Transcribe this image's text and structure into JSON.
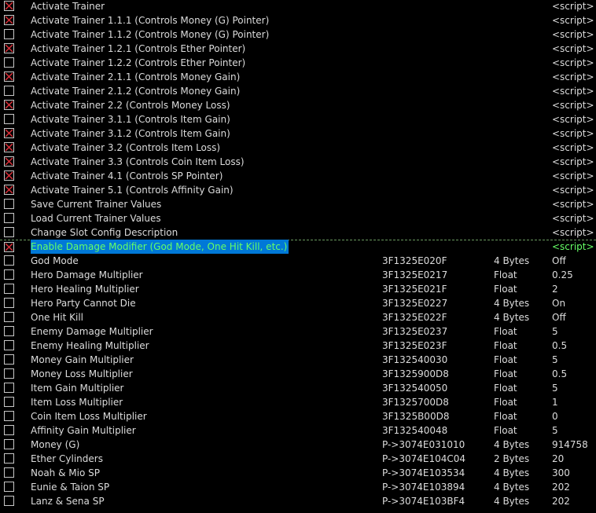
{
  "colors": {
    "background": "#000000",
    "text": "#dcdcdc",
    "checkmark": "#e0303a",
    "selection_bg": "#0078d7",
    "selection_text": "#66ff66"
  },
  "icons": {
    "checkbox_checked": "red-x-checkbox-icon",
    "checkbox_unchecked": "empty-checkbox-icon"
  },
  "rows": [
    {
      "checked": true,
      "description": "Activate Trainer",
      "address": "",
      "type": "",
      "value": "<script>"
    },
    {
      "checked": true,
      "description": "Activate Trainer 1.1.1 (Controls Money (G) Pointer)",
      "address": "",
      "type": "",
      "value": "<script>"
    },
    {
      "checked": false,
      "description": "Activate Trainer 1.1.2 (Controls Money (G) Pointer)",
      "address": "",
      "type": "",
      "value": "<script>"
    },
    {
      "checked": true,
      "description": "Activate Trainer 1.2.1 (Controls Ether Pointer)",
      "address": "",
      "type": "",
      "value": "<script>"
    },
    {
      "checked": false,
      "description": "Activate Trainer 1.2.2 (Controls Ether Pointer)",
      "address": "",
      "type": "",
      "value": "<script>"
    },
    {
      "checked": true,
      "description": "Activate Trainer 2.1.1 (Controls Money Gain)",
      "address": "",
      "type": "",
      "value": "<script>"
    },
    {
      "checked": false,
      "description": "Activate Trainer 2.1.2 (Controls Money Gain)",
      "address": "",
      "type": "",
      "value": "<script>"
    },
    {
      "checked": true,
      "description": "Activate Trainer 2.2 (Controls Money Loss)",
      "address": "",
      "type": "",
      "value": "<script>"
    },
    {
      "checked": false,
      "description": "Activate Trainer 3.1.1 (Controls Item Gain)",
      "address": "",
      "type": "",
      "value": "<script>"
    },
    {
      "checked": true,
      "description": "Activate Trainer 3.1.2 (Controls Item Gain)",
      "address": "",
      "type": "",
      "value": "<script>"
    },
    {
      "checked": true,
      "description": "Activate Trainer 3.2 (Controls Item Loss)",
      "address": "",
      "type": "",
      "value": "<script>"
    },
    {
      "checked": true,
      "description": "Activate Trainer 3.3 (Controls Coin Item Loss)",
      "address": "",
      "type": "",
      "value": "<script>"
    },
    {
      "checked": true,
      "description": "Activate Trainer 4.1 (Controls SP Pointer)",
      "address": "",
      "type": "",
      "value": "<script>"
    },
    {
      "checked": true,
      "description": "Activate Trainer 5.1 (Controls Affinity Gain)",
      "address": "",
      "type": "",
      "value": "<script>"
    },
    {
      "checked": false,
      "description": "Save Current Trainer Values",
      "address": "",
      "type": "",
      "value": "<script>"
    },
    {
      "checked": false,
      "description": "Load Current Trainer Values",
      "address": "",
      "type": "",
      "value": "<script>"
    },
    {
      "checked": false,
      "description": "Change Slot Config Description",
      "address": "",
      "type": "",
      "value": "<script>"
    },
    {
      "checked": true,
      "selected": true,
      "description": "Enable Damage Modifier (God Mode, One Hit Kill, etc.)",
      "address": "",
      "type": "",
      "value": "<script>"
    },
    {
      "checked": false,
      "description": "God Mode",
      "address": "3F1325E020F",
      "type": "4 Bytes",
      "value": "Off"
    },
    {
      "checked": false,
      "description": "Hero Damage Multiplier",
      "address": "3F1325E0217",
      "type": "Float",
      "value": "0.25"
    },
    {
      "checked": false,
      "description": "Hero Healing Multiplier",
      "address": "3F1325E021F",
      "type": "Float",
      "value": "2"
    },
    {
      "checked": false,
      "description": "Hero Party Cannot Die",
      "address": "3F1325E0227",
      "type": "4 Bytes",
      "value": "On"
    },
    {
      "checked": false,
      "description": "One Hit Kill",
      "address": "3F1325E022F",
      "type": "4 Bytes",
      "value": "Off"
    },
    {
      "checked": false,
      "description": "Enemy Damage Multiplier",
      "address": "3F1325E0237",
      "type": "Float",
      "value": "5"
    },
    {
      "checked": false,
      "description": "Enemy Healing Multiplier",
      "address": "3F1325E023F",
      "type": "Float",
      "value": "0.5"
    },
    {
      "checked": false,
      "description": "Money Gain Multiplier",
      "address": "3F132540030",
      "type": "Float",
      "value": "5"
    },
    {
      "checked": false,
      "description": "Money Loss Multiplier",
      "address": "3F1325900D8",
      "type": "Float",
      "value": "0.5"
    },
    {
      "checked": false,
      "description": "Item Gain Multiplier",
      "address": "3F132540050",
      "type": "Float",
      "value": "5"
    },
    {
      "checked": false,
      "description": "Item Loss Multiplier",
      "address": "3F1325700D8",
      "type": "Float",
      "value": "1"
    },
    {
      "checked": false,
      "description": "Coin Item Loss Multiplier",
      "address": "3F1325B00D8",
      "type": "Float",
      "value": "0"
    },
    {
      "checked": false,
      "description": "Affinity Gain Multiplier",
      "address": "3F132540048",
      "type": "Float",
      "value": "5"
    },
    {
      "checked": false,
      "description": "Money (G)",
      "address": "P->3074E031010",
      "type": "4 Bytes",
      "value": "914758"
    },
    {
      "checked": false,
      "description": "Ether Cylinders",
      "address": "P->3074E104C04",
      "type": "2 Bytes",
      "value": "20"
    },
    {
      "checked": false,
      "description": "Noah & Mio SP",
      "address": "P->3074E103534",
      "type": "4 Bytes",
      "value": "300"
    },
    {
      "checked": false,
      "description": "Eunie & Taion SP",
      "address": "P->3074E103894",
      "type": "4 Bytes",
      "value": "202"
    },
    {
      "checked": false,
      "description": "Lanz & Sena SP",
      "address": "P->3074E103BF4",
      "type": "4 Bytes",
      "value": "202"
    }
  ]
}
